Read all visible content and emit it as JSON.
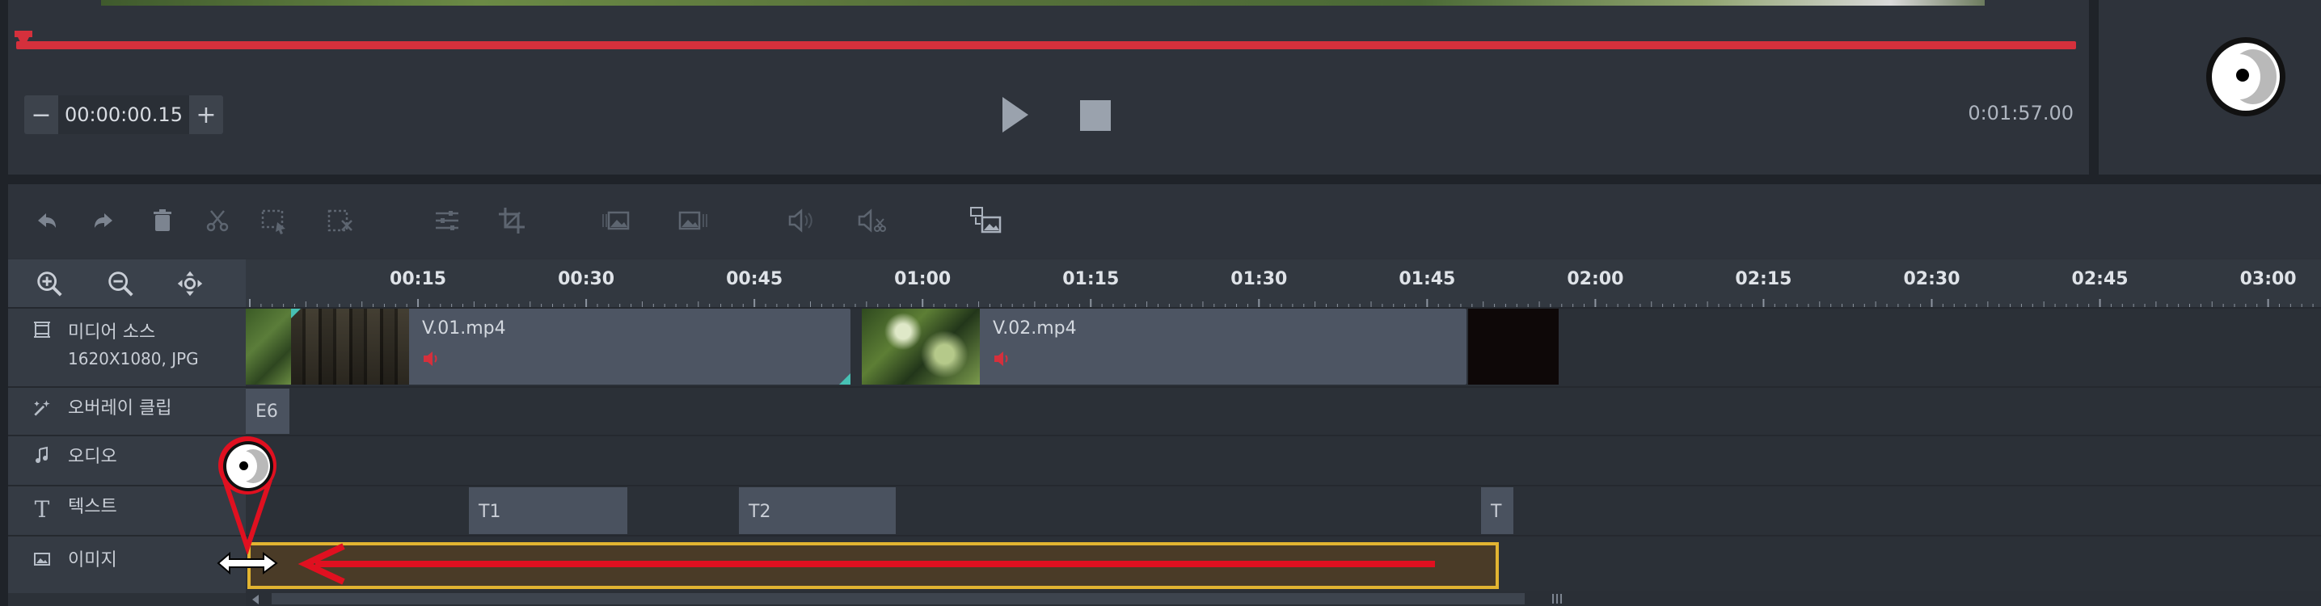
{
  "preview": {
    "timecode": "00:00:00.15",
    "minus_label": "−",
    "plus_label": "+",
    "duration": "0:01:57.00",
    "playhead_fraction": 0.0
  },
  "toolbar": {
    "icons": [
      "undo-icon",
      "redo-icon",
      "delete-icon",
      "cut-icon",
      "select-region-icon",
      "deselect-icon",
      "adjust-icon",
      "crop-icon",
      "image-fit-icon",
      "image-fill-icon",
      "volume-icon",
      "mute-icon",
      "replace-media-icon"
    ]
  },
  "timeline": {
    "ruler_labels": [
      "00:15",
      "00:30",
      "00:45",
      "01:00",
      "01:15",
      "01:30",
      "01:45",
      "02:00",
      "02:15",
      "02:30",
      "02:45",
      "03:00"
    ],
    "tracks": [
      {
        "id": "media",
        "label": "미디어 소스",
        "sublabel": "1620X1080, JPG",
        "icon": "film-icon"
      },
      {
        "id": "overlay",
        "label": "오버레이 클립",
        "icon": "sparkle-icon"
      },
      {
        "id": "audio",
        "label": "오디오",
        "icon": "music-note-icon"
      },
      {
        "id": "text",
        "label": "텍스트",
        "icon": "text-icon"
      },
      {
        "id": "image",
        "label": "이미지",
        "icon": "image-icon"
      }
    ],
    "media_clips": [
      {
        "name": "V.01.mp4"
      },
      {
        "name": "V.02.mp4"
      }
    ],
    "overlay_clip": "E6",
    "text_clips": [
      "T1",
      "T2",
      "T"
    ]
  },
  "colors": {
    "accent_red": "#d5303c",
    "image_clip_border": "#e2b431",
    "image_clip_fill": "#4a3b27",
    "annotation_red": "#e01020"
  }
}
